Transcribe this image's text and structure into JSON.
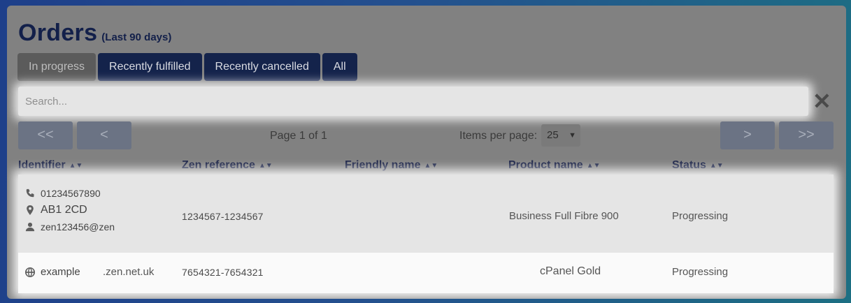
{
  "header": {
    "title": "Orders",
    "subtitle": "(Last 90 days)"
  },
  "tabs": [
    {
      "label": "In progress",
      "active": true
    },
    {
      "label": "Recently fulfilled",
      "active": false
    },
    {
      "label": "Recently cancelled",
      "active": false
    },
    {
      "label": "All",
      "active": false
    }
  ],
  "search": {
    "placeholder": "Search...",
    "value": "",
    "clear_label": "✕"
  },
  "pagination": {
    "first_label": "<<",
    "prev_label": "<",
    "next_label": ">",
    "last_label": ">>",
    "page_info": "Page 1 of 1",
    "items_per_page_label": "Items per page:",
    "items_per_page": "25"
  },
  "table": {
    "columns": [
      "Identifier",
      "Zen reference",
      "Friendly name",
      "Product name",
      "Status"
    ],
    "rows": [
      {
        "phone": "01234567890",
        "postcode": "AB1 2CD",
        "username": "zen123456@zen",
        "zen_reference": "1234567-1234567",
        "friendly_name": "",
        "product_name": "Business Full Fibre 900",
        "status": "Progressing"
      },
      {
        "domain_name": "example",
        "domain_suffix": ".zen.net.uk",
        "zen_reference": "7654321-7654321",
        "friendly_name": "",
        "product_name": "cPanel Gold",
        "status": "Progressing"
      }
    ]
  },
  "colors": {
    "navy": "#14234b",
    "panel": "#818181",
    "active_tab": "#5b5b5b"
  },
  "icons": [
    "phone-icon",
    "location-pin-icon",
    "user-icon",
    "globe-icon",
    "sort-icon",
    "close-icon"
  ]
}
